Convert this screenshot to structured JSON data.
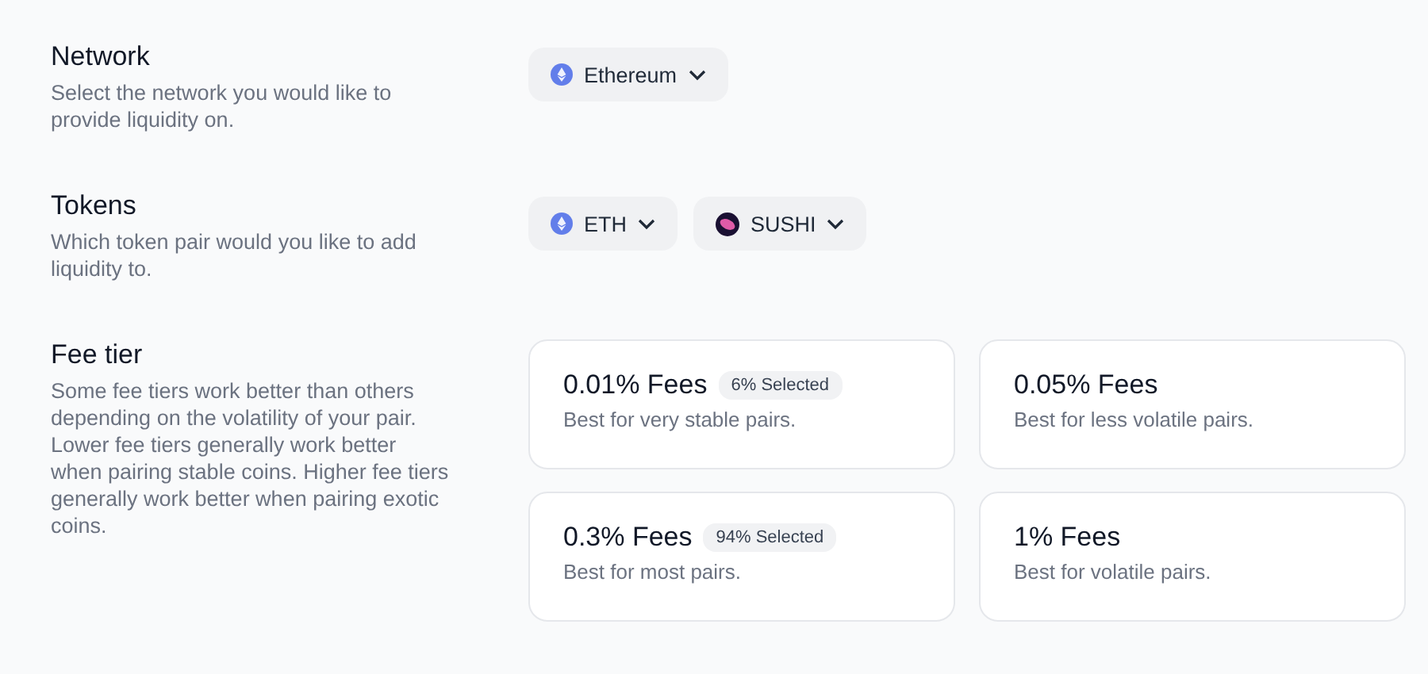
{
  "sections": [
    {
      "kind": "dropdowns",
      "title": "Network",
      "description": "Select the network you would like to provide liquidity on.",
      "dropdowns": [
        {
          "label": "Ethereum",
          "kind": "eth"
        }
      ]
    },
    {
      "kind": "dropdowns",
      "title": "Tokens",
      "description": "Which token pair would you like to add liquidity to.",
      "dropdowns": [
        {
          "label": "ETH",
          "kind": "eth"
        },
        {
          "label": "SUSHI",
          "kind": "sushi"
        }
      ]
    },
    {
      "kind": "fees",
      "title": "Fee tier",
      "description": "Some fee tiers work better than others depending on the volatility of your pair. Lower fee tiers generally work better when pairing stable coins. Higher fee tiers generally work better when pairing exotic coins.",
      "fees": [
        {
          "title": "0.01% Fees",
          "badge": "6% Selected",
          "subtitle": "Best for very stable pairs."
        },
        {
          "title": "0.05% Fees",
          "subtitle": "Best for less volatile pairs."
        },
        {
          "title": "0.3% Fees",
          "badge": "94% Selected",
          "subtitle": "Best for most pairs."
        },
        {
          "title": "1% Fees",
          "subtitle": "Best for volatile pairs."
        }
      ]
    }
  ]
}
